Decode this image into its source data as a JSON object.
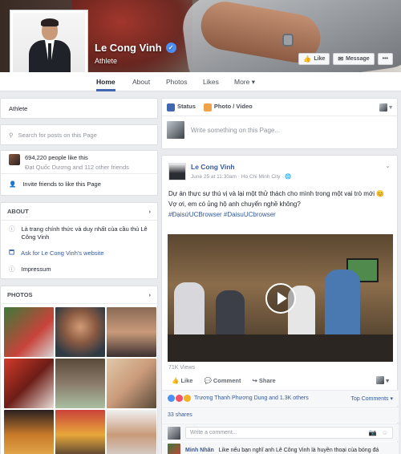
{
  "page": {
    "name": "Le Cong Vinh",
    "category": "Athlete"
  },
  "cover_actions": {
    "like_label": "Like",
    "message_label": "Message",
    "more_label": "•••"
  },
  "tabs": [
    {
      "label": "Home"
    },
    {
      "label": "About"
    },
    {
      "label": "Photos"
    },
    {
      "label": "Likes"
    },
    {
      "label": "More"
    }
  ],
  "sidebar": {
    "category": "Athlete",
    "search_placeholder": "Search for posts on this Page",
    "likes_count_text": "694,220 people like this",
    "friends_text": "Đạt Quốc Dương and 112 other friends",
    "invite_text": "Invite friends to like this Page",
    "about_header": "ABOUT",
    "about_desc": "Là trang chính thức và duy nhất của cầu thủ Lê Công Vinh",
    "website_link": "Ask for Le Cong Vinh's website",
    "impressum": "Impressum",
    "photos_header": "PHOTOS"
  },
  "composer": {
    "status_tab": "Status",
    "photo_tab": "Photo / Video",
    "placeholder": "Write something on this Page..."
  },
  "post": {
    "author": "Le Cong Vinh",
    "meta": "June 25 at 11:30am · Ho Chi Minh City ·",
    "text_line1": "Dự án thực sự thú vị và lại một thử thách cho mình trong một vai trò mới 😊",
    "text_line2": "Vợ ơi, em có ủng hộ anh chuyển nghề không?",
    "hashtags": "#ĐạisứUCBrowser #DaisuUCbrowser",
    "views": "71K Views",
    "like_label": "Like",
    "comment_label": "Comment",
    "share_label": "Share",
    "reactions_text": "Trương Thanh Phương Dung and 1.3K others",
    "top_comments": "Top Comments ▾",
    "shares_text": "33 shares",
    "comment_placeholder": "Write a comment...",
    "comment_author": "Minh Nhân",
    "comment_text": "Like nếu bạn nghĩ anh Lê Công Vinh là huyền thoại của bóng đá"
  },
  "colors": {
    "accent": "#4267b2",
    "link": "#365899",
    "verified": "#4c8ff6"
  }
}
